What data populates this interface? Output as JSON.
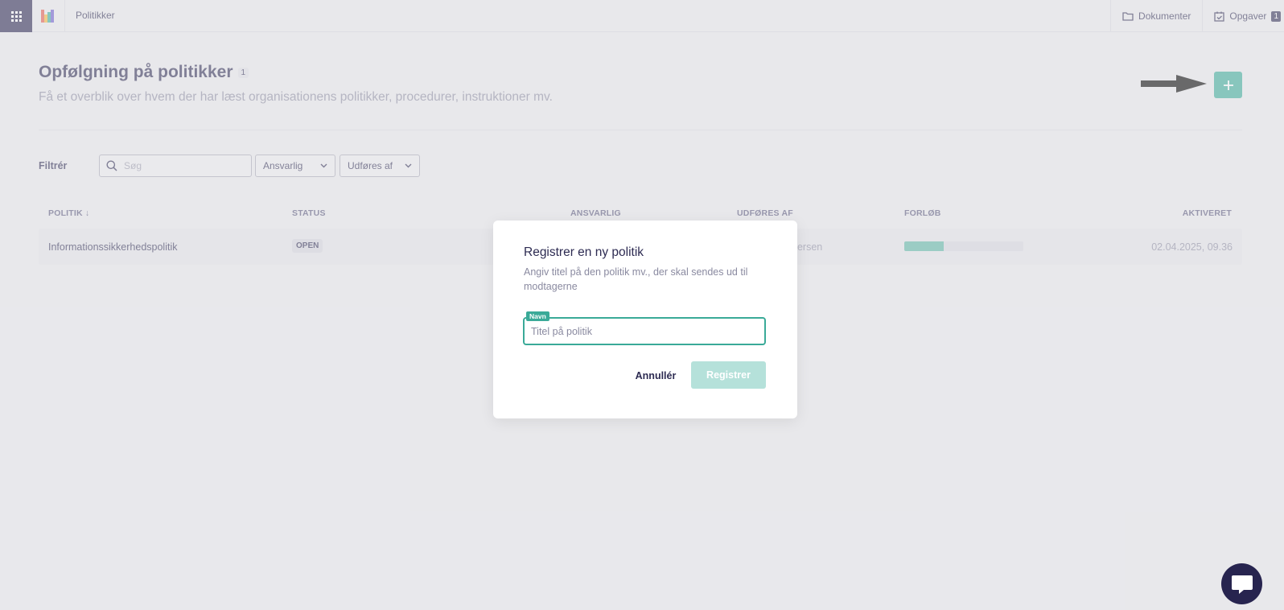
{
  "topbar": {
    "breadcrumb": "Politikker",
    "documents_label": "Dokumenter",
    "tasks_label": "Opgaver",
    "tasks_count": "1"
  },
  "header": {
    "title": "Opfølgning på politikker",
    "count": "1",
    "subtitle": "Få et overblik over hvem der har læst organisationens politikker, procedurer, instruktioner mv."
  },
  "filter": {
    "label": "Filtrér",
    "search_placeholder": "Søg",
    "responsible_select": "Ansvarlig",
    "performed_by_select": "Udføres af"
  },
  "table": {
    "columns": {
      "policy": "POLITIK ↓",
      "status": "STATUS",
      "responsible": "ANSVARLIG",
      "performed_by": "UDFØRES AF",
      "progress": "FORLØB",
      "activated": "AKTIVERET"
    },
    "rows": [
      {
        "policy": "Informationssikkerhedspolitik",
        "status": "OPEN",
        "performed_by_visible": "dersen",
        "progress": 0.33,
        "activated": "02.04.2025, 09.36"
      }
    ]
  },
  "modal": {
    "title": "Registrer en ny politik",
    "description": "Angiv titel på den politik mv., der skal sendes ud til modtagerne",
    "field_label": "Navn",
    "field_placeholder": "Titel på politik",
    "field_value": "",
    "cancel_label": "Annullér",
    "submit_label": "Registrer"
  },
  "colors": {
    "accent": "#3aaa98",
    "accent_disabled": "#b5e1da",
    "dark": "#27244f"
  }
}
